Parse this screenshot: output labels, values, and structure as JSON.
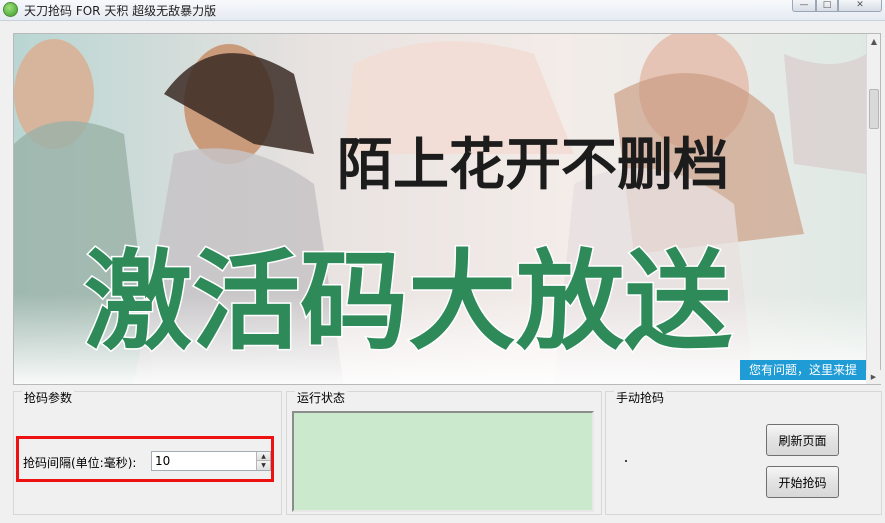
{
  "window": {
    "title": "天刀抢码 FOR 天积 超级无敌暴力版",
    "minimize_glyph": "—",
    "maximize_glyph": "□",
    "close_glyph": "✕"
  },
  "banner": {
    "headline": "陌上花开不删档",
    "slogan": "激活码大放送",
    "help_link": "您有问题，这里来提"
  },
  "params_group": {
    "title": "抢码参数",
    "interval_label": "抢码间隔(单位:毫秒):",
    "interval_value": "10"
  },
  "status_group": {
    "title": "运行状态"
  },
  "manual_group": {
    "title": "手动抢码",
    "refresh_button": "刷新页面",
    "start_button": "开始抢码"
  },
  "colors": {
    "status_bg": "#cbe9cd",
    "highlight_border": "#ee1111",
    "help_badge_bg": "#1f9bd6",
    "slogan_green": "#2f8a5a"
  }
}
